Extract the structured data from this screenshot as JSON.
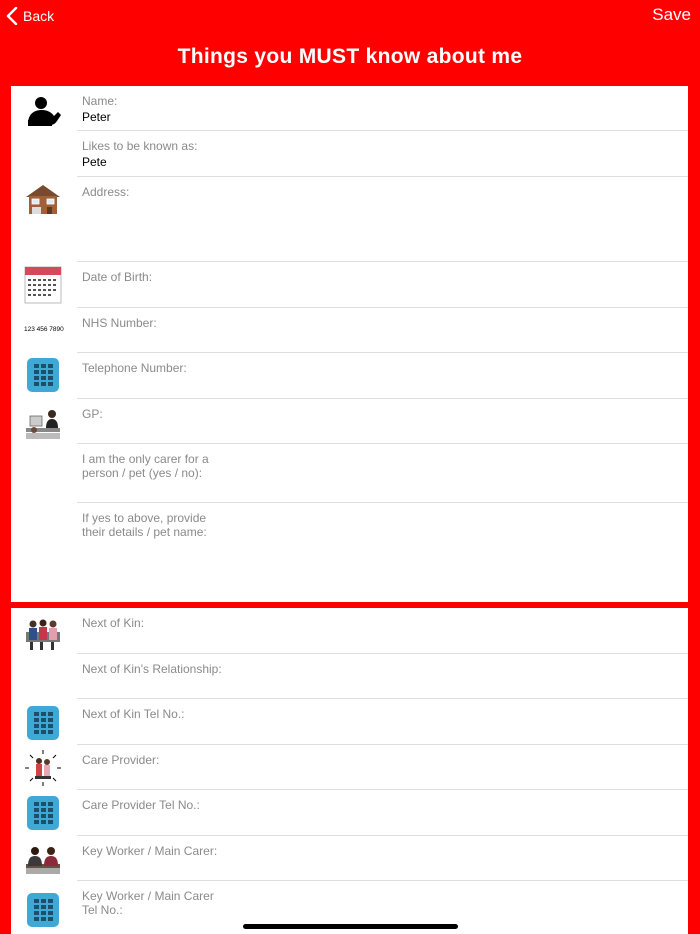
{
  "nav": {
    "back_label": "Back",
    "save_label": "Save"
  },
  "page_title": "Things you MUST know about me",
  "section1": {
    "name": {
      "label": "Name:",
      "value": "Peter"
    },
    "known_as": {
      "label": "Likes to be known as:",
      "value": "Pete"
    },
    "address": {
      "label": "Address:",
      "value": ""
    },
    "dob": {
      "label": "Date of Birth:",
      "value": ""
    },
    "nhs": {
      "label": "NHS Number:",
      "value": "",
      "icon_text": "123 456 7890"
    },
    "telephone": {
      "label": "Telephone Number:",
      "value": ""
    },
    "gp": {
      "label": "GP:",
      "value": ""
    },
    "only_carer": {
      "label": "I am the only carer for a\nperson / pet (yes / no):",
      "value": ""
    },
    "carer_details": {
      "label": "If yes to above, provide\ntheir details / pet name:",
      "value": ""
    }
  },
  "section2": {
    "next_of_kin": {
      "label": "Next of Kin:",
      "value": ""
    },
    "nok_relationship": {
      "label": "Next of Kin's Relationship:",
      "value": ""
    },
    "nok_tel": {
      "label": "Next of Kin Tel No.:",
      "value": ""
    },
    "care_provider": {
      "label": "Care Provider:",
      "value": ""
    },
    "care_provider_tel": {
      "label": "Care Provider Tel No.:",
      "value": ""
    },
    "key_worker": {
      "label": "Key Worker / Main Carer:",
      "value": ""
    },
    "key_worker_tel": {
      "label": "Key Worker / Main Carer\nTel No.:",
      "value": ""
    }
  },
  "icons": {
    "person": "person-silhouette-icon",
    "house": "house-icon",
    "calendar": "calendar-icon",
    "phone": "phone-icon",
    "doctor": "doctor-icon",
    "family": "family-icon",
    "care": "care-provider-icon",
    "keyworker": "key-worker-icon"
  },
  "colors": {
    "accent": "#ff0000",
    "phone_blue": "#3fa9d6"
  }
}
